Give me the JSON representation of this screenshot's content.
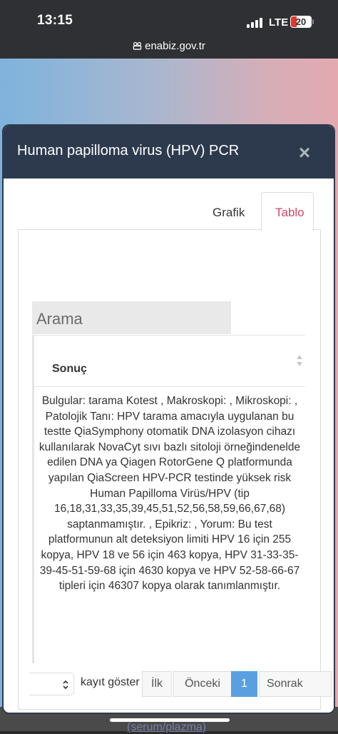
{
  "status_bar": {
    "time": "13:15",
    "network": "LTE",
    "battery": "20"
  },
  "browser": {
    "url": "enabiz.gov.tr"
  },
  "modal": {
    "title": "Human papilloma virus (HPV) PCR",
    "close_label": "×",
    "tabs": [
      {
        "label": "Grafik",
        "active": false
      },
      {
        "label": "Tablo",
        "active": true
      }
    ],
    "search_label": "Arama",
    "table": {
      "column": "Sonuç",
      "rows": [
        "Bulgular: tarama Kotest , Makroskopi: , Mikroskopi: , Patolojik Tanı: HPV tarama amacıyla uygulanan bu testte QiaSymphony otomatik DNA izolasyon cihazı kullanılarak NovaCyt sıvı bazlı sitoloji örneğindenelde edilen DNA ya Qiagen RotorGene Q platformunda yapılan QiaScreen HPV-PCR testinde yüksek risk Human Papilloma Virüs/HPV (tip 16,18,31,33,35,39,45,51,52,56,58,59,66,67,68) saptanmamıştır. , Epikriz: , Yorum: Bu test platformunun alt deteksiyon limiti HPV 16 için 255 kopya, HPV 18 ve 56 için 463 kopya, HPV 31-33-35-39-45-51-59-68 için 4630 kopya ve HPV 52-58-66-67 tipleri için 46307 kopya olarak tanımlanmıştır."
      ]
    },
    "page_size_label": "kayıt göster",
    "pagination": {
      "first": "İlk",
      "previous": "Önceki",
      "current": "1",
      "next": "Sonrak"
    }
  },
  "background_link": "(serum/plazma)",
  "colors": {
    "header_bg": "#2d3a4e",
    "active_tab": "#d04a63",
    "active_page": "#5aa0e0"
  }
}
